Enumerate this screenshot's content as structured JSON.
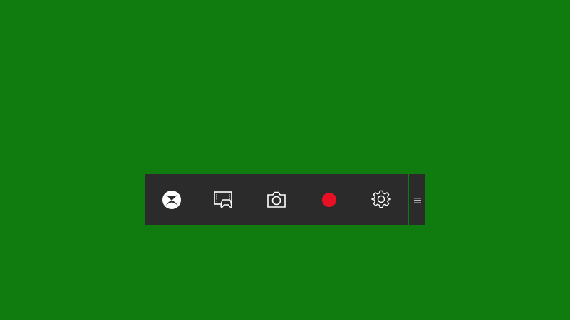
{
  "colors": {
    "background": "#107c10",
    "bar": "#2b2b2b",
    "icon": "#ffffff",
    "record": "#e81123",
    "divider": "#107c10"
  },
  "game_bar": {
    "buttons": [
      {
        "id": "xbox",
        "icon": "xbox-logo-icon"
      },
      {
        "id": "game-mode",
        "icon": "game-controller-screen-icon"
      },
      {
        "id": "screenshot",
        "icon": "camera-icon"
      },
      {
        "id": "record",
        "icon": "record-dot-icon"
      },
      {
        "id": "settings",
        "icon": "gear-icon"
      }
    ],
    "grip_icon": "drag-handle-icon"
  }
}
